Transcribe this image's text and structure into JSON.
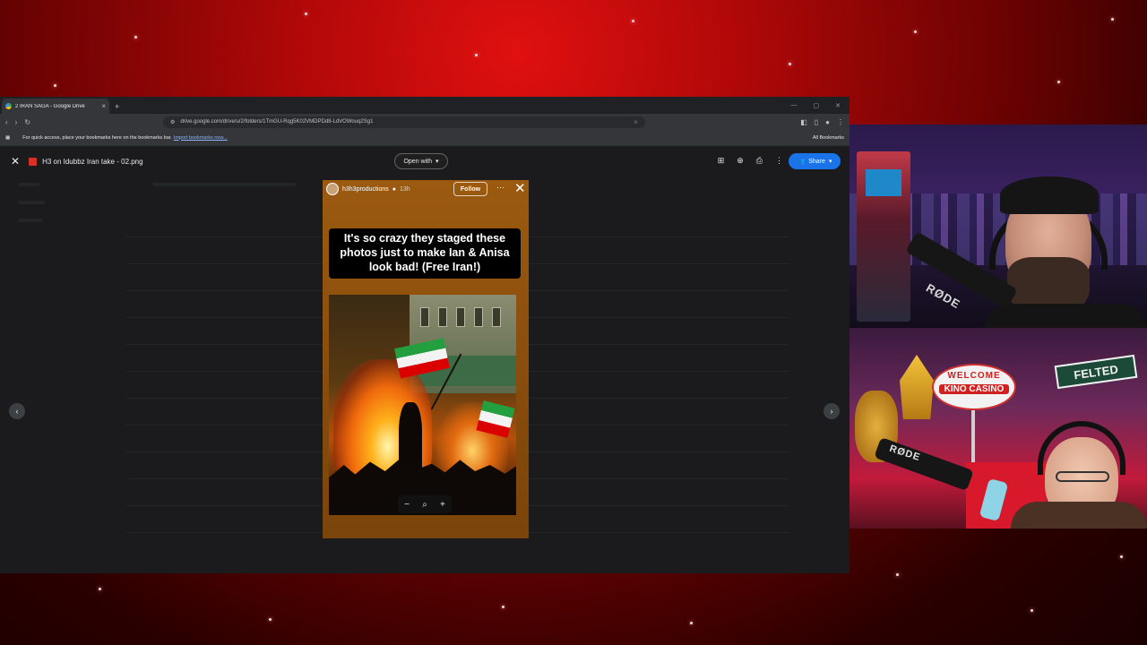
{
  "browser": {
    "tab_title": "2 IRAN SAGA - Google Drive",
    "tab_close": "×",
    "new_tab": "+",
    "url": "drive.google.com/drive/u/2/folders/1TmGU-Rqg5K02VMDPDd8-LdVOWouq2Sg1",
    "bookmarks_hint": "For quick access, place your bookmarks here on the bookmarks bar.",
    "import_link": "Import bookmarks now...",
    "all_bookmarks": "All Bookmarks"
  },
  "viewer": {
    "file_name": "H3 on Idubbz Iran take - 02.png",
    "open_with": "Open with",
    "share": "Share"
  },
  "story": {
    "username": "h3h3productions",
    "time": "13h",
    "follow": "Follow",
    "caption": "It's so crazy they staged these photos just to make Ian & Anisa look bad! (Free Iran!)"
  },
  "webcam": {
    "mic_brand_1": "RØDE",
    "mic_brand_2": "RØDE",
    "sign_welcome": "WELCOME",
    "sign_casino": "KINO CASINO",
    "felted": "FELTED"
  },
  "icons": [
    "back-icon",
    "forward-icon",
    "reload-icon",
    "star-icon",
    "close-icon",
    "print-icon",
    "more-icon",
    "zoom-out-icon",
    "zoom-in-icon",
    "search-icon",
    "arrow-left-icon",
    "arrow-right-icon"
  ],
  "colors": {
    "share_blue": "#1a73e8",
    "background_red": "#b00808"
  }
}
